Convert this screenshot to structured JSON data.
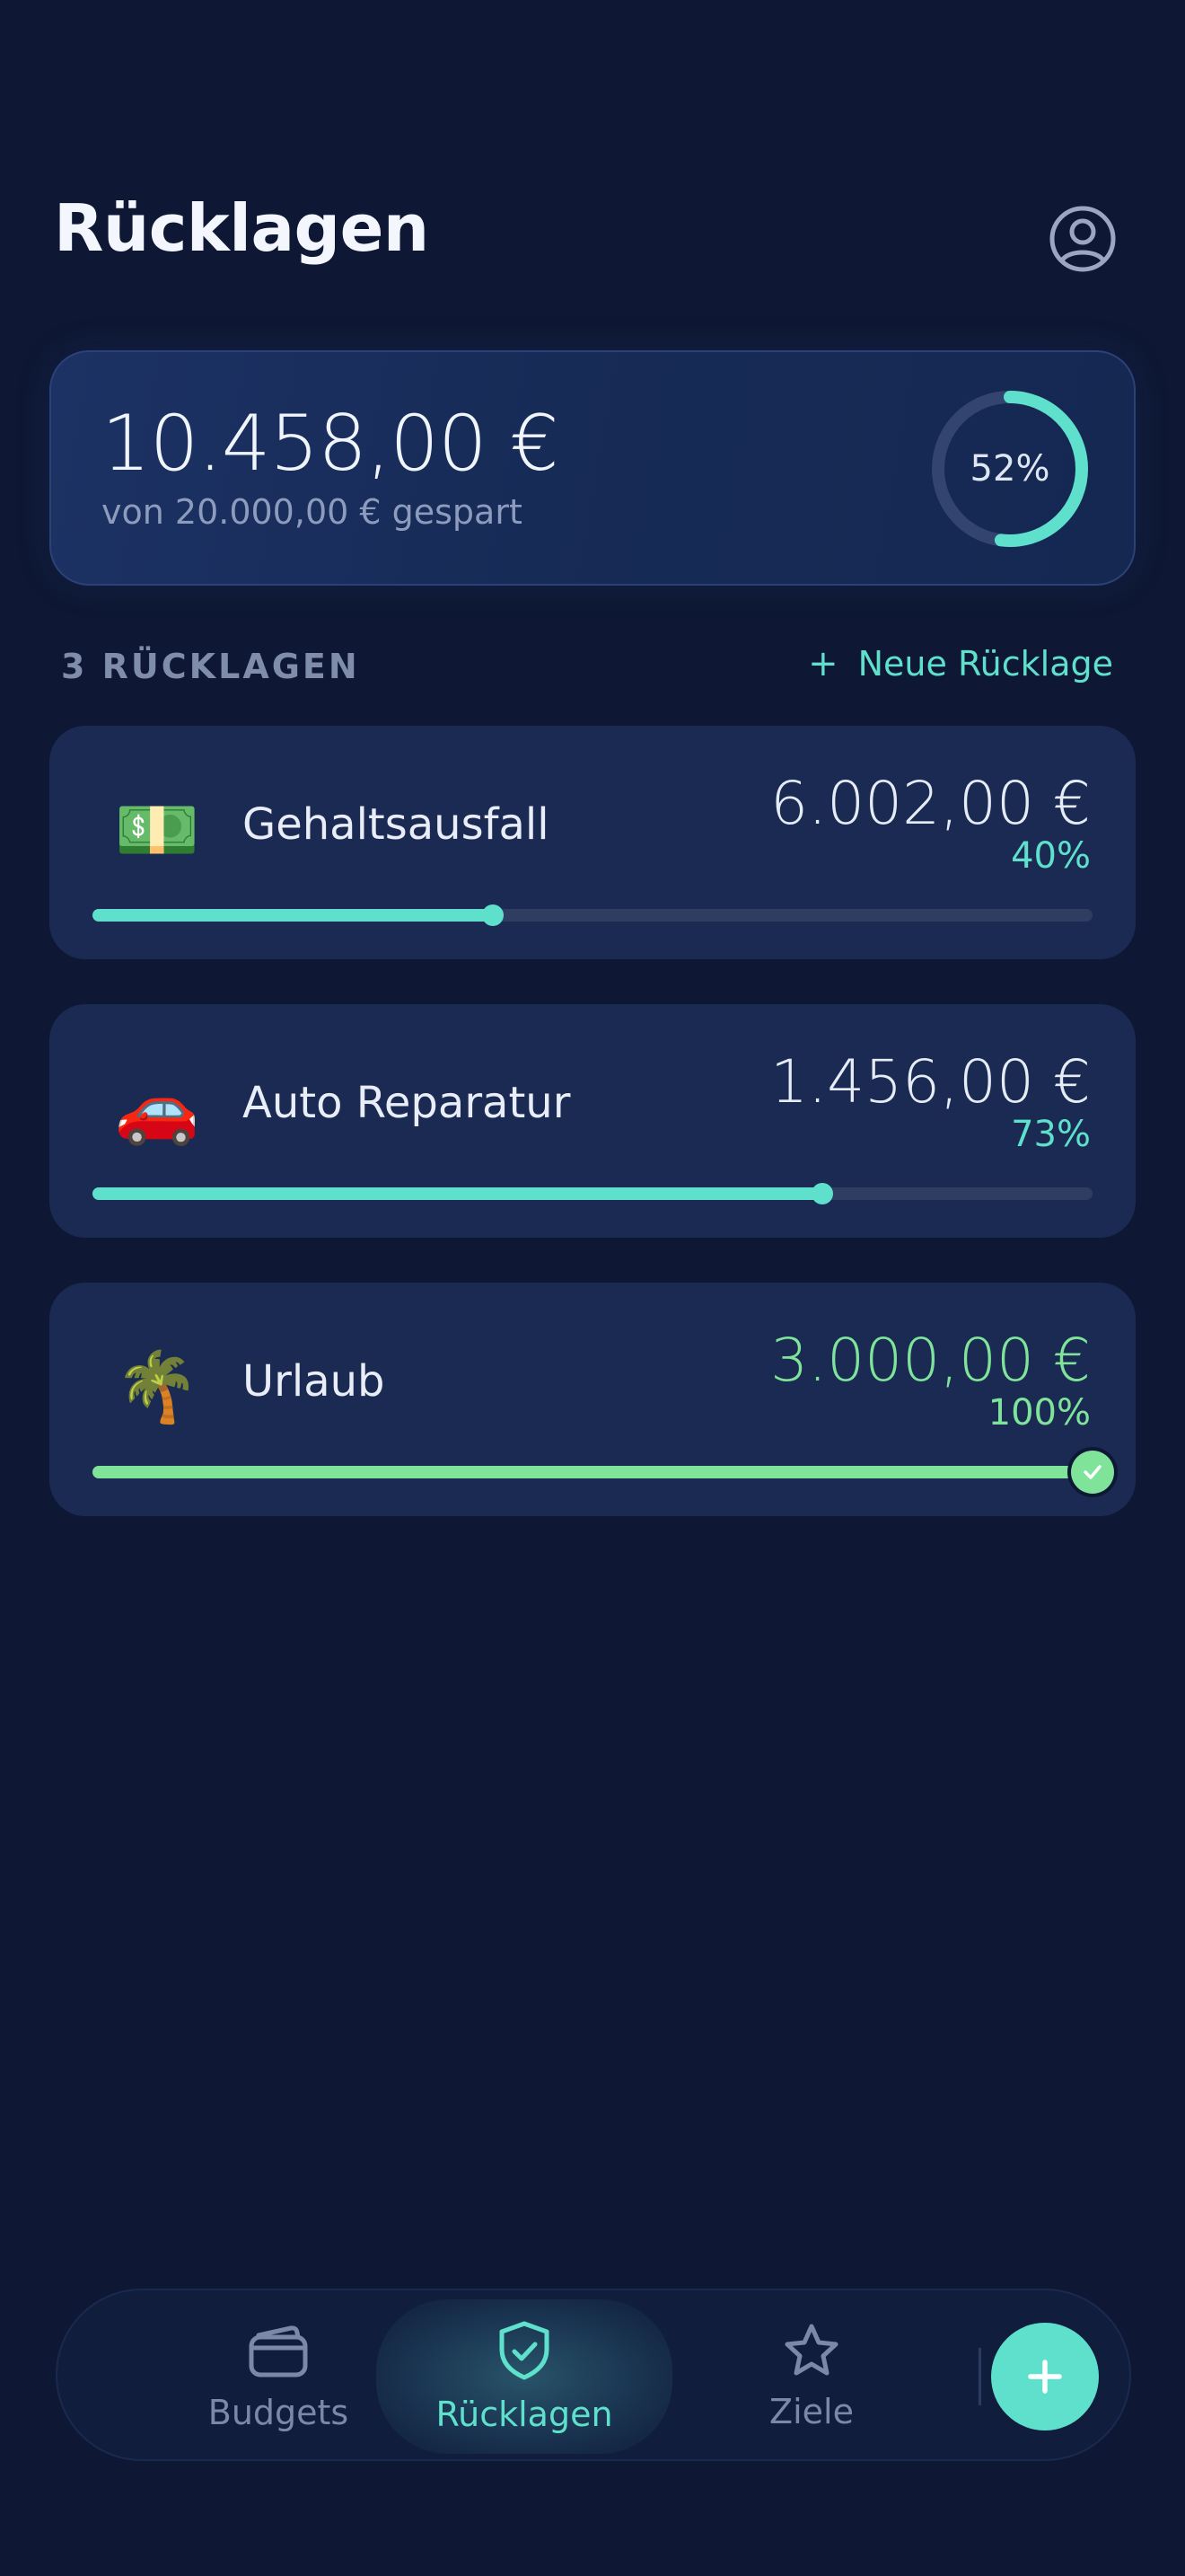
{
  "header": {
    "title": "Rücklagen"
  },
  "summary": {
    "amount": "10.458,00 €",
    "subtitle": "von 20.000,00 € gespart",
    "percent_label": "52%",
    "progress_fraction": 0.52
  },
  "section": {
    "count_label": "3 RÜCKLAGEN",
    "new_plus": "+",
    "new_label": "Neue Rücklage"
  },
  "reserves": [
    {
      "emoji": "💵",
      "name": "Gehaltsausfall",
      "amount": "6.002,00 €",
      "percent": "40%",
      "progress_fraction": 0.4
    },
    {
      "emoji": "🚗",
      "name": "Auto Reparatur",
      "amount": "1.456,00 €",
      "percent": "73%",
      "progress_fraction": 0.73
    },
    {
      "emoji": "🌴",
      "name": "Urlaub",
      "amount": "3.000,00 €",
      "percent": "100%",
      "progress_fraction": 1.0
    }
  ],
  "nav": {
    "items": [
      {
        "label": "Budgets",
        "icon": "wallet-icon"
      },
      {
        "label": "Rücklagen",
        "icon": "shield-check-icon"
      },
      {
        "label": "Ziele",
        "icon": "star-icon"
      }
    ],
    "active": "Rücklagen",
    "fab_icon": "plus-icon"
  },
  "colors": {
    "background": "#0e1834",
    "card": "#1a2a52",
    "accent": "#5fe0cc",
    "complete": "#7fe39a",
    "muted": "#7b88a8"
  }
}
